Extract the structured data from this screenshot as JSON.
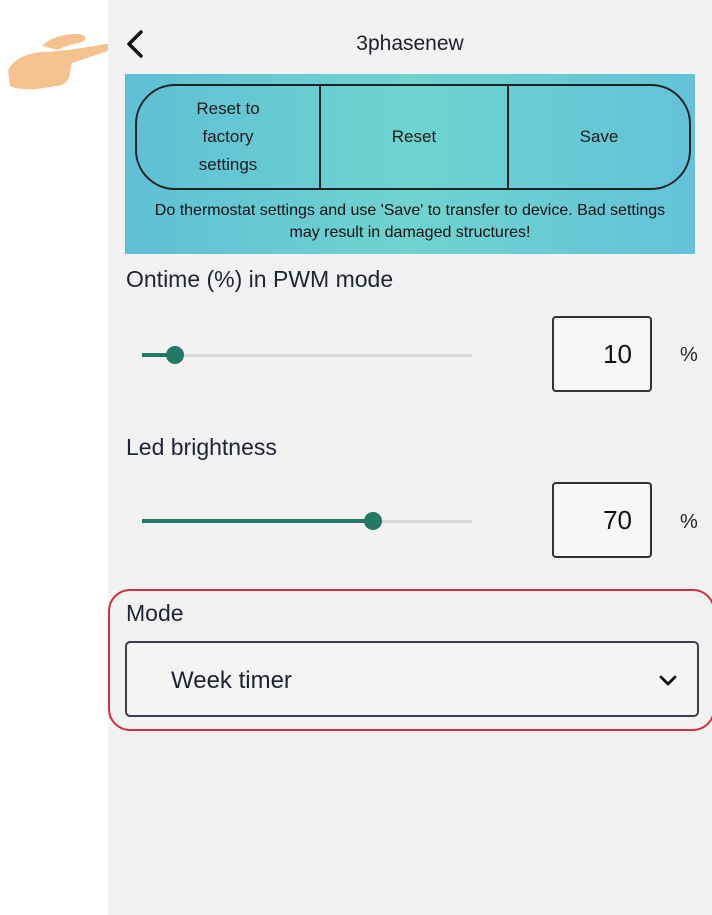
{
  "header": {
    "title": "3phasenew",
    "back_icon": "chevron-left-icon"
  },
  "banner": {
    "buttons": [
      "Reset to factory settings",
      "Reset",
      "Save"
    ],
    "note": "Do thermostat settings and use 'Save' to transfer to device. Bad settings may result in damaged structures!"
  },
  "settings": {
    "ontime": {
      "label": "Ontime (%) in PWM mode",
      "value": "10",
      "unit": "%",
      "slider_fraction": 0.1
    },
    "led": {
      "label": "Led brightness",
      "value": "70",
      "unit": "%",
      "slider_fraction": 0.7
    }
  },
  "mode": {
    "label": "Mode",
    "selected": "Week timer",
    "chevron_icon": "chevron-down-icon"
  },
  "colors": {
    "accent": "#227a66",
    "highlight": "#d32f3a",
    "banner": "#66c7d6"
  }
}
